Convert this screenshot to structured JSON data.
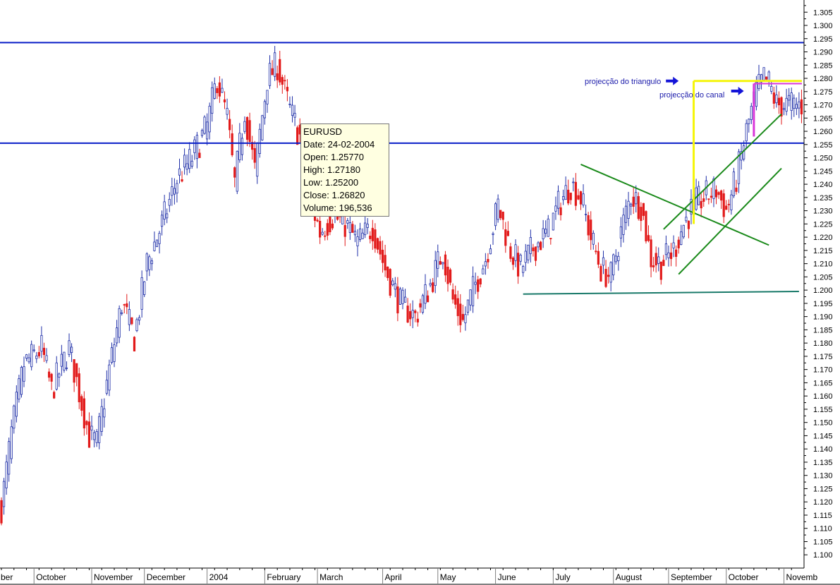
{
  "chart_data": {
    "type": "candlestick",
    "symbol": "EURUSD",
    "colors": {
      "up": "#1f2fa8",
      "down": "#e21a1a",
      "background": "#ffffff",
      "axis": "#000000",
      "hline": "#0a1fc8",
      "trendline": "#1a8a1a",
      "support": "#1a7a6a",
      "triangle_projection": "#f5f50a",
      "channel_projection": "#d936d9",
      "grid": "#808080"
    },
    "ylim": [
      1.095,
      1.308
    ],
    "yticks": [
      "1.305",
      "1.300",
      "1.295",
      "1.290",
      "1.285",
      "1.280",
      "1.275",
      "1.270",
      "1.265",
      "1.260",
      "1.255",
      "1.250",
      "1.245",
      "1.240",
      "1.235",
      "1.230",
      "1.225",
      "1.220",
      "1.215",
      "1.210",
      "1.205",
      "1.200",
      "1.195",
      "1.190",
      "1.185",
      "1.180",
      "1.175",
      "1.170",
      "1.165",
      "1.160",
      "1.155",
      "1.150",
      "1.145",
      "1.140",
      "1.135",
      "1.130",
      "1.125",
      "1.120",
      "1.115",
      "1.110",
      "1.105",
      "1.100"
    ],
    "months": [
      {
        "label": "ber",
        "index": 0
      },
      {
        "label": "October",
        "index": 13
      },
      {
        "label": "November",
        "index": 36
      },
      {
        "label": "December",
        "index": 57
      },
      {
        "label": "2004",
        "index": 82
      },
      {
        "label": "February",
        "index": 105
      },
      {
        "label": "March",
        "index": 126
      },
      {
        "label": "April",
        "index": 152
      },
      {
        "label": "May",
        "index": 174
      },
      {
        "label": "June",
        "index": 197
      },
      {
        "label": "July",
        "index": 220
      },
      {
        "label": "August",
        "index": 244
      },
      {
        "label": "September",
        "index": 266
      },
      {
        "label": "October",
        "index": 289
      },
      {
        "label": "Novemb",
        "index": 312
      }
    ],
    "anchors": [
      [
        0,
        1.118
      ],
      [
        4,
        1.146
      ],
      [
        9,
        1.172
      ],
      [
        16,
        1.178
      ],
      [
        20,
        1.162
      ],
      [
        27,
        1.178
      ],
      [
        35,
        1.145
      ],
      [
        38,
        1.142
      ],
      [
        43,
        1.17
      ],
      [
        48,
        1.195
      ],
      [
        53,
        1.182
      ],
      [
        58,
        1.21
      ],
      [
        64,
        1.225
      ],
      [
        70,
        1.242
      ],
      [
        76,
        1.25
      ],
      [
        82,
        1.262
      ],
      [
        86,
        1.28
      ],
      [
        90,
        1.265
      ],
      [
        93,
        1.24
      ],
      [
        97,
        1.268
      ],
      [
        101,
        1.245
      ],
      [
        106,
        1.28
      ],
      [
        110,
        1.285
      ],
      [
        115,
        1.268
      ],
      [
        119,
        1.258
      ],
      [
        123,
        1.235
      ],
      [
        127,
        1.222
      ],
      [
        132,
        1.228
      ],
      [
        137,
        1.225
      ],
      [
        142,
        1.218
      ],
      [
        148,
        1.224
      ],
      [
        153,
        1.208
      ],
      [
        159,
        1.195
      ],
      [
        165,
        1.19
      ],
      [
        171,
        1.202
      ],
      [
        176,
        1.215
      ],
      [
        180,
        1.196
      ],
      [
        184,
        1.188
      ],
      [
        188,
        1.2
      ],
      [
        193,
        1.212
      ],
      [
        198,
        1.232
      ],
      [
        203,
        1.215
      ],
      [
        207,
        1.208
      ],
      [
        212,
        1.216
      ],
      [
        218,
        1.222
      ],
      [
        222,
        1.232
      ],
      [
        227,
        1.24
      ],
      [
        231,
        1.235
      ],
      [
        235,
        1.22
      ],
      [
        239,
        1.208
      ],
      [
        243,
        1.205
      ],
      [
        247,
        1.222
      ],
      [
        251,
        1.236
      ],
      [
        255,
        1.232
      ],
      [
        259,
        1.212
      ],
      [
        263,
        1.21
      ],
      [
        268,
        1.215
      ],
      [
        272,
        1.225
      ],
      [
        276,
        1.232
      ],
      [
        280,
        1.235
      ],
      [
        285,
        1.238
      ],
      [
        289,
        1.23
      ],
      [
        293,
        1.242
      ],
      [
        297,
        1.26
      ],
      [
        301,
        1.275
      ],
      [
        304,
        1.28
      ],
      [
        306,
        1.278
      ],
      [
        309,
        1.27
      ]
    ],
    "horizontal_lines": [
      1.2935,
      1.2555
    ],
    "trendlines": [
      {
        "from": [
          231,
          1.2475
        ],
        "to": [
          306,
          1.217
        ]
      },
      {
        "from": [
          264,
          1.223
        ],
        "to": [
          311,
          1.2665
        ]
      },
      {
        "from": [
          270,
          1.206
        ],
        "to": [
          311,
          1.246
        ]
      },
      {
        "from": [
          208,
          1.1985
        ],
        "to": [
          318,
          1.1995
        ]
      }
    ],
    "annotations": [
      {
        "text": "projecção do triangulo",
        "value": 1.279
      },
      {
        "text": "projecção do canal",
        "value": 1.276
      }
    ],
    "tooltip": {
      "symbol": "EURUSD",
      "date": "Date: 24-02-2004",
      "open": "Open: 1.25770",
      "high": "High: 1.27180",
      "low": "Low: 1.25200",
      "close": "Close: 1.26820",
      "volume": "Volume: 196,536"
    }
  }
}
